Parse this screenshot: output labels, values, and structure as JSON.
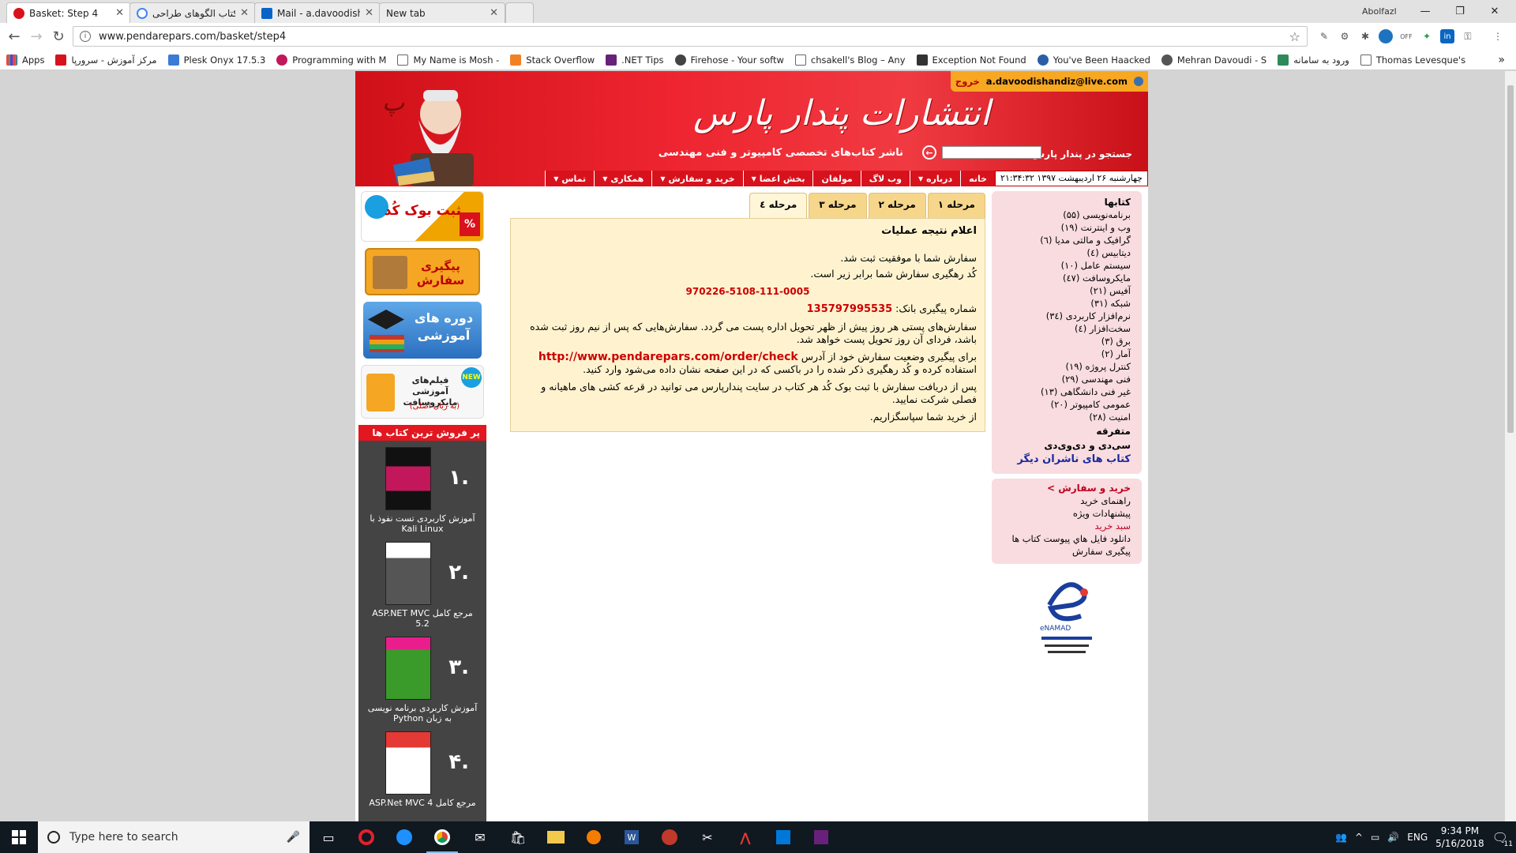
{
  "browser": {
    "tabs": [
      {
        "title": "Basket: Step 4",
        "icon_color": "#d8121c"
      },
      {
        "title": "خرید کتاب الگوهای طراحی",
        "icon_color": "#4285f4"
      },
      {
        "title": "Mail - a.davoodishandiz@",
        "icon_color": "#0a64c8"
      },
      {
        "title": "New tab",
        "icon_color": ""
      }
    ],
    "profile_name": "Abolfazl",
    "url": "www.pendarepars.com/basket/step4",
    "bookmarks": [
      {
        "label": "Apps",
        "color": "#d13b2b"
      },
      {
        "label": "مرکز آموزش - سرورپا",
        "color": "#d8121c"
      },
      {
        "label": "Plesk Onyx 17.5.3",
        "color": "#3b7bd6"
      },
      {
        "label": "Programming with M",
        "color": "#c2185b"
      },
      {
        "label": "My Name is Mosh -",
        "color": "#666666"
      },
      {
        "label": "Stack Overflow",
        "color": "#f48024"
      },
      {
        "label": ".NET Tips",
        "color": "#68217a"
      },
      {
        "label": "Firehose - Your softw",
        "color": "#444444"
      },
      {
        "label": "chsakell's Blog – Any",
        "color": "#666666"
      },
      {
        "label": "Exception Not Found",
        "color": "#333333"
      },
      {
        "label": "You've Been Haacked",
        "color": "#2a5fa8"
      },
      {
        "label": "Mehran Davoudi - S",
        "color": "#555555"
      },
      {
        "label": "ورود به سامانه",
        "color": "#2e8b57"
      },
      {
        "label": "Thomas Levesque's",
        "color": "#666666"
      }
    ]
  },
  "site": {
    "logo_title": "انتشارات پندار پارس",
    "logo_subtitle": "ناشر کتاب‌های تخصصی کامپیوتر و فنی مهندسی",
    "search_label": "جستجو در پندار پارس",
    "user_email": "a.davoodishandiz@live.com",
    "logout_label": "خروج",
    "date_time": "چهارشنبه ۲۶ اردیبهشت ۱۳۹۷ ۲۱:۳۴:۳۲",
    "nav": [
      {
        "label": "خانه",
        "dropdown": false
      },
      {
        "label": "درباره",
        "dropdown": true
      },
      {
        "label": "وب لاگ",
        "dropdown": false
      },
      {
        "label": "مولفان",
        "dropdown": false
      },
      {
        "label": "بخش اعضا",
        "dropdown": true
      },
      {
        "label": "خرید و سفارش",
        "dropdown": true
      },
      {
        "label": "همکاری",
        "dropdown": true
      },
      {
        "label": "تماس",
        "dropdown": true
      }
    ],
    "promos": [
      {
        "label": "ثبت بوک کُد",
        "bg": "#1a9fe0"
      },
      {
        "label": "پیگیری سفارش",
        "bg": "#f5a623"
      },
      {
        "label": "دوره های آموزشی",
        "bg": "#2a6fbf"
      },
      {
        "label": "فیلم‌های آموزشی مایکروسافت",
        "sub": "(به زبان اصلی)",
        "badge": "NEW",
        "bg": "#f7f7f7"
      }
    ],
    "bestsellers": {
      "heading": "پر فروش ترین کتاب ها",
      "items": [
        {
          "rank": "۱.",
          "title": "آموزش کاربردی تست نفوذ با Kali Linux",
          "cover": "#c2185b"
        },
        {
          "rank": "۲.",
          "title": "مرجع کامل ASP.NET MVC 5.2",
          "cover": "#555555"
        },
        {
          "rank": "۳.",
          "title": "آموزش کاربردی برنامه نویسی به زبان Python",
          "cover": "#3a9a2a"
        },
        {
          "rank": "۴.",
          "title": "مرجع کامل ASP.Net MVC 4",
          "cover": "#e53935"
        }
      ]
    },
    "steps": [
      "مرحله ۱",
      "مرحله ۲",
      "مرحله ۳",
      "مرحله ٤"
    ],
    "result": {
      "heading": "اعلام نتیجه عملیات",
      "line1": "سفارش شما با موفقیت ثبت شد.",
      "line2": "کُد رهگیری سفارش شما برابر زیر است.",
      "tracking_code": "970226-5108-111-0005",
      "bank_label": "شماره پیگیری بانک:",
      "bank_number": "135797995535",
      "shipping_note": "سفارش‌های پستی هر روز پیش از ظهر تحویل اداره پست می گردد. سفارش‌هایی که پس از نیم روز ثبت شده باشد، فردای آن روز تحویل پست خواهد شد.",
      "check_prefix": "برای پیگیری وضعیت سفارش خود از آدرس",
      "check_url": "http://www.pendarepars.com/order/check",
      "check_suffix": "استفاده کرده و کُد رهگیری ذکر شده را در باکسی که در این صفحه نشان داده می‌شود وارد کنید.",
      "lottery_note": "پس از دریافت سفارش با ثبت بوک کُد هر کتاب در سایت پندارپارس می توانید در قرعه کشی های ماهیانه و فصلی شرکت نمایید.",
      "thanks": "از خرید شما سپاسگزاریم."
    },
    "categories": {
      "heading": "کتابها",
      "items": [
        "برنامه‌نویسی (۵۵)",
        "وب و اینترنت (۱۹)",
        "گرافیک و مالتی مدیا (٦)",
        "دیتابیس (٤)",
        "سیستم عامل (۱۰)",
        "مایکروسافت (٤٧)",
        "آفیس (۲۱)",
        "شبکه (۳۱)",
        "نرم‌افزار کاربردی (۳٤)",
        "سخت‌افزار (٤)",
        "برق (۳)",
        "آمار (۲)",
        "کنترل پروژه (۱۹)",
        "فنی مهندسی (۲۹)",
        "غیر فنی دانشگاهی (۱۳)",
        "عمومی کامپیوتر (۲۰)",
        "امنیت (۲۸)"
      ],
      "misc": "متفرقه",
      "cd_dvd": "سی‌دی و دی‌وی‌دی",
      "other_publishers": "کتاب های ناشران دیگر"
    },
    "shop": {
      "heading": "خرید و سفارش >",
      "items": [
        "راهنمای خرید",
        "پیشنهادات ویژه"
      ],
      "cart": "سبد خرید",
      "items2": [
        "دانلود فایل هاي پيوست كتاب ها",
        "پیگیری سفارش"
      ]
    },
    "enamad": "eNAMAD"
  },
  "taskbar": {
    "search_placeholder": "Type here to search",
    "lang": "ENG",
    "time": "9:34 PM",
    "date": "5/16/2018",
    "notif_count": "11"
  }
}
